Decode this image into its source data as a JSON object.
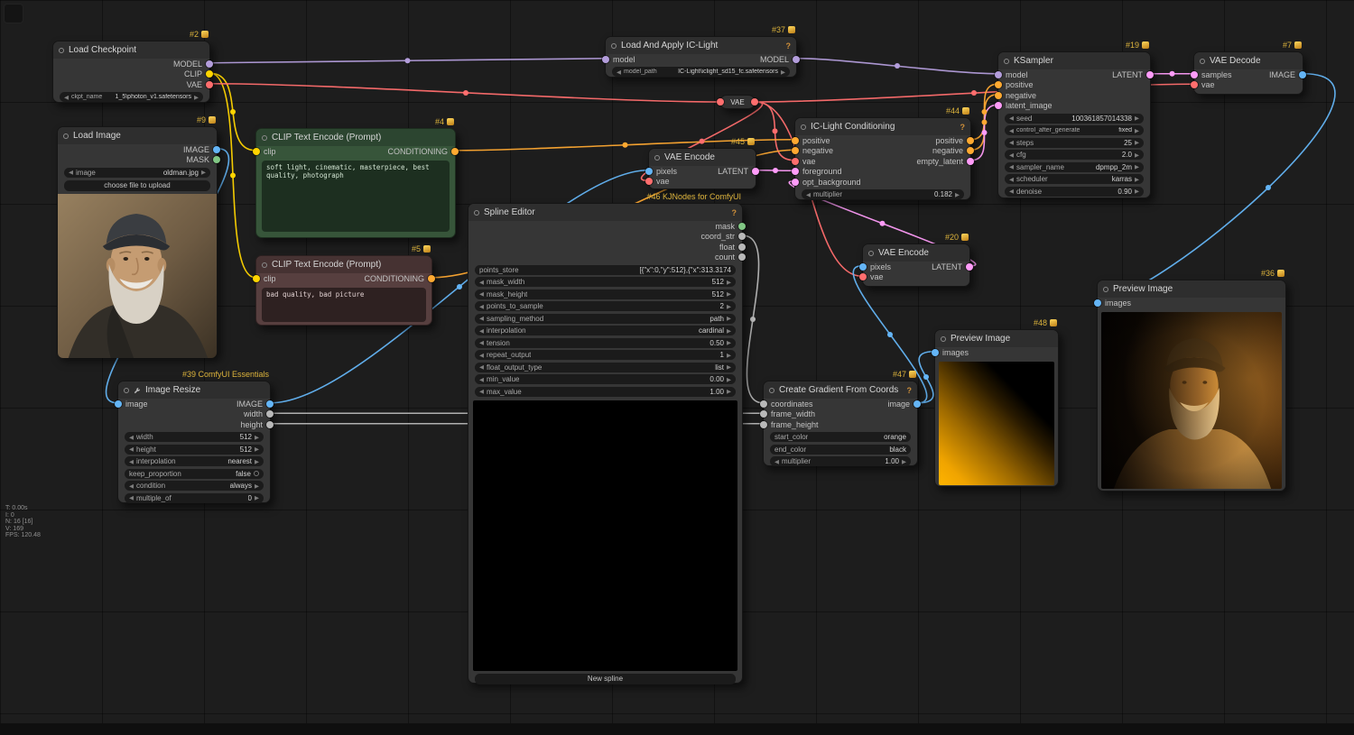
{
  "stats": {
    "lines": [
      "T: 0.00s",
      "I: 0",
      "N: 16 [16]",
      "V: 169",
      "FPS: 120.48"
    ]
  },
  "types": {
    "MODEL": "#B39DDB",
    "CLIP": "#FFD500",
    "VAE": "#FF6E6E",
    "CONDITIONING": "#FFA931",
    "LATENT": "#FF9CF9",
    "IMAGE": "#64B5F6",
    "MASK": "#81C784",
    "STRING": "#B8B8B8",
    "INT": "#B8B8B8",
    "FLOAT": "#B8B8B8"
  },
  "nodes": {
    "checkpoint": {
      "badge": "#2",
      "title": "Load Checkpoint",
      "outputs": [
        "MODEL",
        "CLIP",
        "VAE"
      ],
      "widget": {
        "name": "ckpt_name",
        "value": "1_5\\photon_v1.safetensors"
      }
    },
    "load_image": {
      "badge": "#9",
      "title": "Load Image",
      "outputs": [
        "IMAGE",
        "MASK"
      ],
      "widget": {
        "name": "image",
        "value": "oldman.jpg"
      },
      "button": "choose file to upload"
    },
    "clip_pos": {
      "badge": "#4",
      "title": "CLIP Text Encode (Prompt)",
      "input": "clip",
      "output": "CONDITIONING",
      "text": "soft light, cinematic, masterpiece, best quality, photograph"
    },
    "clip_neg": {
      "badge": "#5",
      "title": "CLIP Text Encode (Prompt)",
      "input": "clip",
      "output": "CONDITIONING",
      "text": "bad quality, bad picture"
    },
    "ic_loader": {
      "badge": "#37",
      "title": "Load And Apply IC-Light",
      "help": "?",
      "input": "model",
      "output": "MODEL",
      "widget": {
        "name": "model_path",
        "value": "IC-Light\\iclight_sd15_fc.safetensors"
      }
    },
    "vae_encode_a": {
      "badge": "#45",
      "title": "VAE Encode",
      "inputs": [
        "pixels",
        "vae"
      ],
      "output": "LATENT"
    },
    "reroute": {
      "title": "VAE"
    },
    "ic_cond": {
      "badge": "#44",
      "title": "IC-Light Conditioning",
      "help": "?",
      "inputs": [
        "positive",
        "negative",
        "vae",
        "foreground",
        "opt_background"
      ],
      "outputs": [
        "positive",
        "negative",
        "empty_latent"
      ],
      "widget": {
        "name": "multiplier",
        "value": "0.182"
      }
    },
    "spline": {
      "badge": "#46 KJNodes for ComfyUI",
      "title": "Spline Editor",
      "help": "?",
      "outputs": [
        "mask",
        "coord_str",
        "float",
        "count"
      ],
      "widgets": [
        {
          "name": "points_store",
          "value": "[{\"x\":0,\"y\":512},{\"x\":313.3174"
        },
        {
          "name": "mask_width",
          "value": "512"
        },
        {
          "name": "mask_height",
          "value": "512"
        },
        {
          "name": "points_to_sample",
          "value": "2"
        },
        {
          "name": "sampling_method",
          "value": "path"
        },
        {
          "name": "interpolation",
          "value": "cardinal"
        },
        {
          "name": "tension",
          "value": "0.50"
        },
        {
          "name": "repeat_output",
          "value": "1"
        },
        {
          "name": "float_output_type",
          "value": "list"
        },
        {
          "name": "min_value",
          "value": "0.00"
        },
        {
          "name": "max_value",
          "value": "1.00"
        }
      ],
      "button": "New spline"
    },
    "ksampler": {
      "badge": "#19",
      "title": "KSampler",
      "inputs": [
        "model",
        "positive",
        "negative",
        "latent_image"
      ],
      "output": "LATENT",
      "widgets": [
        {
          "name": "seed",
          "value": "100361857014338"
        },
        {
          "name": "control_after_generate",
          "value": "fixed"
        },
        {
          "name": "steps",
          "value": "25"
        },
        {
          "name": "cfg",
          "value": "2.0"
        },
        {
          "name": "sampler_name",
          "value": "dpmpp_2m"
        },
        {
          "name": "scheduler",
          "value": "karras"
        },
        {
          "name": "denoise",
          "value": "0.90"
        }
      ]
    },
    "vae_decode": {
      "badge": "#7",
      "title": "VAE Decode",
      "inputs": [
        "samples",
        "vae"
      ],
      "output": "IMAGE"
    },
    "vae_encode_b": {
      "badge": "#20",
      "title": "VAE Encode",
      "inputs": [
        "pixels",
        "vae"
      ],
      "output": "LATENT"
    },
    "resize": {
      "badge": "#39 ComfyUI Essentials",
      "title": "Image Resize",
      "input": "image",
      "outputs": [
        "IMAGE",
        "width",
        "height"
      ],
      "widgets": [
        {
          "name": "width",
          "value": "512"
        },
        {
          "name": "height",
          "value": "512"
        },
        {
          "name": "interpolation",
          "value": "nearest"
        },
        {
          "name": "keep_proportion",
          "value": "false"
        },
        {
          "name": "condition",
          "value": "always"
        },
        {
          "name": "multiple_of",
          "value": "0"
        }
      ]
    },
    "gradient": {
      "badge": "#47",
      "title": "Create Gradient From Coords",
      "help": "?",
      "inputs": [
        "coordinates",
        "frame_width",
        "frame_height"
      ],
      "output": "image",
      "widgets": [
        {
          "name": "start_color",
          "value": "orange"
        },
        {
          "name": "end_color",
          "value": "black"
        },
        {
          "name": "multiplier",
          "value": "1.00"
        }
      ]
    },
    "preview_grad": {
      "badge": "#48",
      "title": "Preview Image",
      "input": "images"
    },
    "preview_final": {
      "badge": "#36",
      "title": "Preview Image",
      "input": "images"
    }
  }
}
